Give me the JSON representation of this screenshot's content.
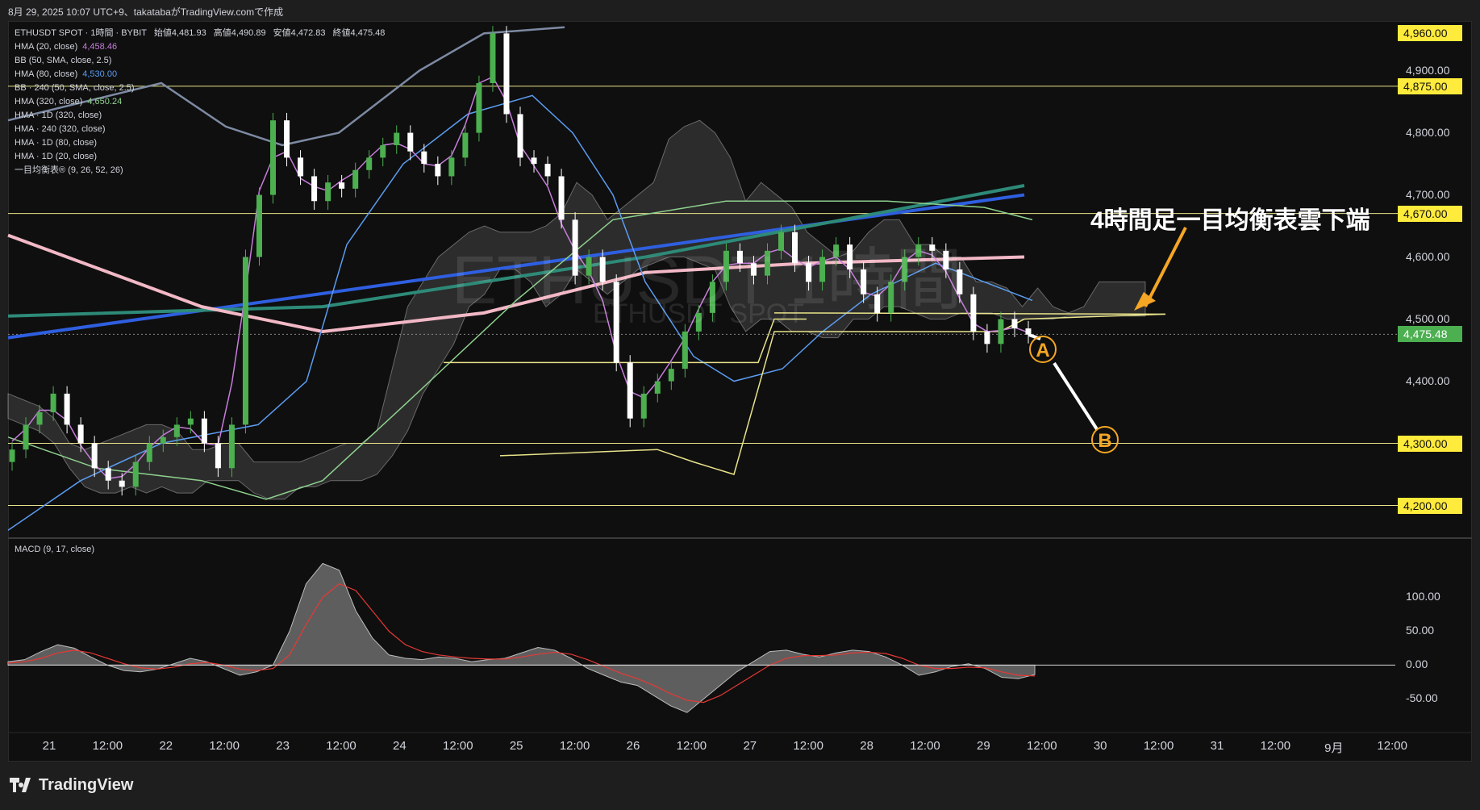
{
  "header": {
    "text": "8月 29, 2025 10:07 UTC+9、takatabaがTradingView.comで作成"
  },
  "legend": {
    "symbol_line": {
      "symbol": "ETHUSDT SPOT · 1時間 · BYBIT",
      "open_label": "始値",
      "open": "4,481.93",
      "high_label": "高値",
      "high": "4,490.89",
      "low_label": "安値",
      "low": "4,472.83",
      "close_label": "終値",
      "close": "4,475.48"
    },
    "indicators": [
      {
        "name": "HMA (20, close)",
        "value": "4,458.46",
        "color": "#c77ddb"
      },
      {
        "name": "BB (50, SMA, close, 2.5)",
        "value": "",
        "color": ""
      },
      {
        "name": "HMA (80, close)",
        "value": "4,530.00",
        "color": "#5b9cf0"
      },
      {
        "name": "BB · 240 (50, SMA, close, 2.5)",
        "value": "",
        "color": ""
      },
      {
        "name": "HMA (320, close)",
        "value": "4,650.24",
        "color": "#8fd18f"
      },
      {
        "name": "HMA · 1D (320, close)",
        "value": "",
        "color": ""
      },
      {
        "name": "HMA · 240 (320, close)",
        "value": "",
        "color": ""
      },
      {
        "name": "HMA · 1D (80, close)",
        "value": "",
        "color": ""
      },
      {
        "name": "HMA · 1D (20, close)",
        "value": "",
        "color": ""
      },
      {
        "name": "一目均衡表® (9, 26, 52, 26)",
        "value": "",
        "color": ""
      }
    ]
  },
  "watermark": {
    "line1": "ETHUSDT 1時間",
    "line2": "ETHUSDT SPOT"
  },
  "annotation": {
    "title": "4時間足一目均衡表雲下端",
    "point_a": "A",
    "point_b": "B"
  },
  "macd": {
    "label": "MACD (9, 17, close)"
  },
  "footer": {
    "brand": "TradingView"
  },
  "colors": {
    "up": "#4caf50",
    "down": "#ffffff",
    "tag": "#ffeb3b",
    "orange": "#f5a623",
    "hline": "#e8e38a"
  },
  "chart_data": [
    {
      "type": "candlestick",
      "title": "ETHUSDT SPOT · 1時間 · BYBIT",
      "ylim": [
        4150,
        4980
      ],
      "price_ticks": [
        4900,
        4800,
        4700,
        4600,
        4500,
        4400
      ],
      "price_tags": [
        "4,960.00",
        "4,875.00",
        "4,670.00",
        "4,475.48",
        "4,300.00",
        "4,200.00"
      ],
      "horizontal_levels": [
        4875,
        4670,
        4300,
        4200
      ],
      "current_price": 4475.48,
      "x_labels": [
        "21",
        "12:00",
        "22",
        "12:00",
        "23",
        "12:00",
        "24",
        "12:00",
        "25",
        "12:00",
        "26",
        "12:00",
        "27",
        "12:00",
        "28",
        "12:00",
        "29",
        "12:00",
        "30",
        "12:00",
        "31",
        "12:00",
        "9月",
        "12:00"
      ],
      "close_path": [
        4290,
        4330,
        4350,
        4380,
        4330,
        4300,
        4260,
        4240,
        4230,
        4270,
        4300,
        4310,
        4330,
        4340,
        4300,
        4260,
        4330,
        4600,
        4700,
        4820,
        4760,
        4730,
        4690,
        4720,
        4710,
        4740,
        4760,
        4780,
        4800,
        4770,
        4750,
        4730,
        4760,
        4800,
        4880,
        4960,
        4830,
        4760,
        4750,
        4730,
        4660,
        4570,
        4600,
        4560,
        4430,
        4340,
        4380,
        4400,
        4420,
        4480,
        4510,
        4560,
        4610,
        4590,
        4570,
        4610,
        4640,
        4590,
        4560,
        4600,
        4620,
        4580,
        4540,
        4510,
        4560,
        4600,
        4620,
        4610,
        4580,
        4540,
        4480,
        4460,
        4500,
        4485,
        4475
      ]
    },
    {
      "type": "area",
      "title": "MACD (9, 17, close)",
      "ylim": [
        -90,
        160
      ],
      "y_ticks": [
        "100.00",
        "50.00",
        "0.00",
        "-50.00"
      ],
      "macd": [
        5,
        8,
        20,
        30,
        25,
        12,
        0,
        -8,
        -10,
        -6,
        2,
        10,
        5,
        -5,
        -15,
        -10,
        0,
        50,
        120,
        150,
        140,
        80,
        40,
        15,
        10,
        8,
        12,
        10,
        5,
        8,
        10,
        18,
        26,
        22,
        10,
        -5,
        -15,
        -25,
        -30,
        -45,
        -60,
        -70,
        -50,
        -30,
        -10,
        5,
        20,
        22,
        16,
        12,
        18,
        22,
        20,
        12,
        0,
        -15,
        -10,
        -2,
        2,
        -5,
        -18,
        -20,
        -14
      ],
      "signal": [
        3,
        5,
        10,
        18,
        22,
        18,
        10,
        2,
        -4,
        -6,
        -3,
        2,
        4,
        0,
        -6,
        -8,
        -5,
        15,
        60,
        100,
        120,
        110,
        80,
        50,
        30,
        20,
        15,
        12,
        10,
        9,
        9,
        12,
        16,
        19,
        16,
        8,
        -2,
        -12,
        -20,
        -30,
        -42,
        -52,
        -55,
        -45,
        -30,
        -15,
        0,
        10,
        14,
        14,
        15,
        18,
        19,
        17,
        10,
        0,
        -5,
        -5,
        -3,
        -4,
        -10,
        -15,
        -16
      ]
    }
  ]
}
